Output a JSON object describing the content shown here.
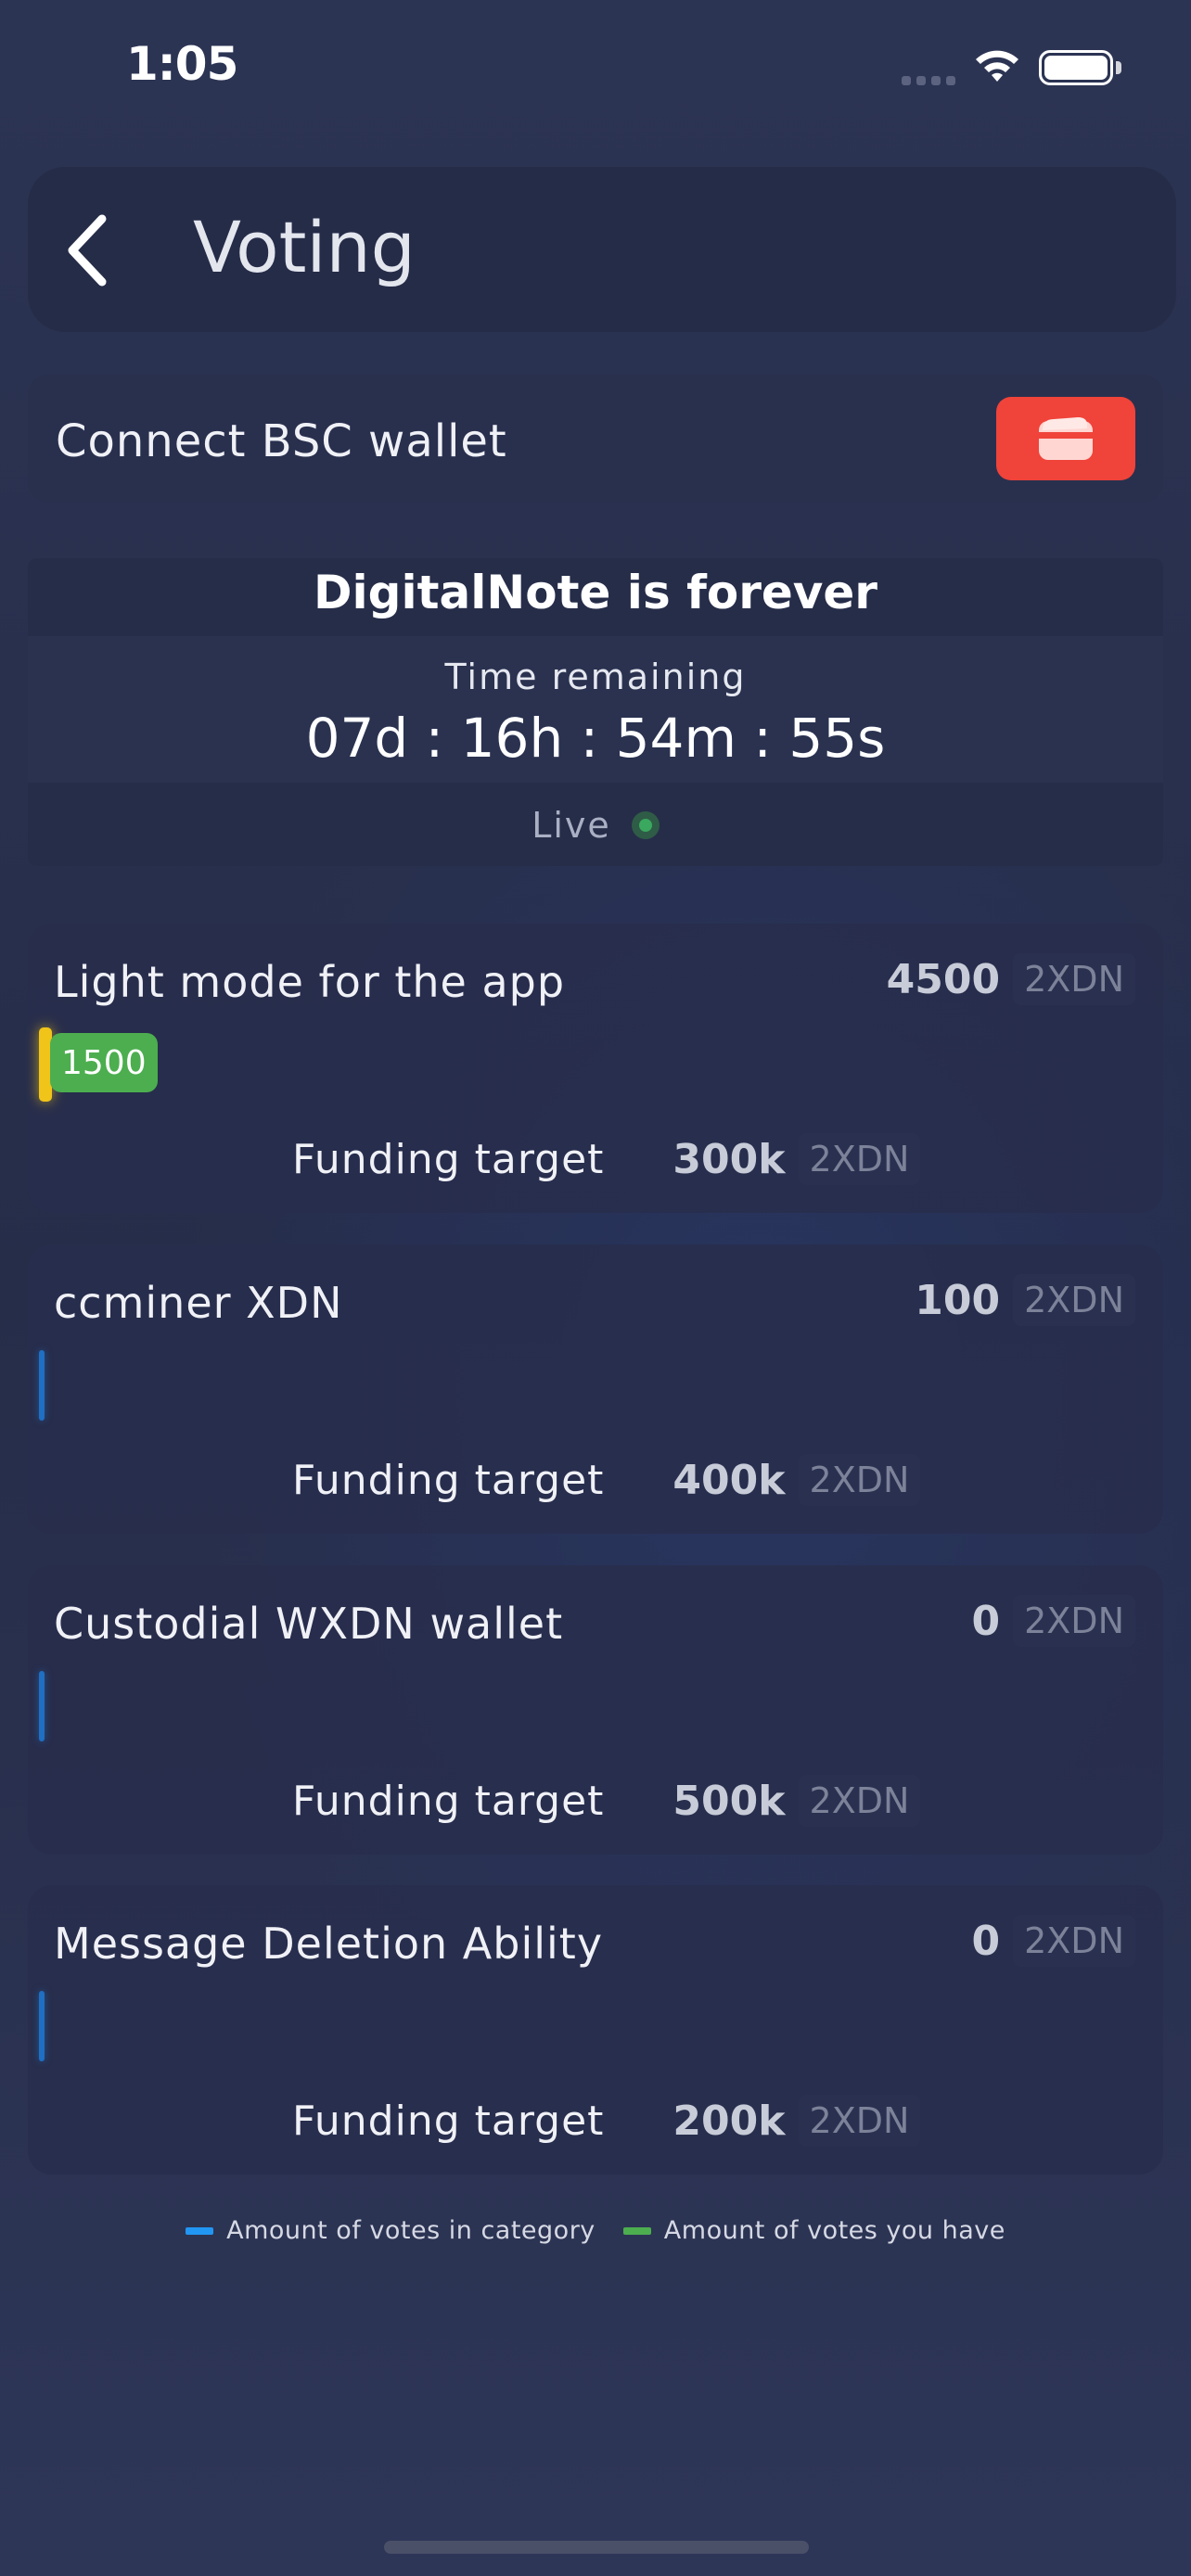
{
  "status_bar": {
    "time": "1:05",
    "battery_level": 1.0
  },
  "header": {
    "title": "Voting",
    "back_icon": "chevron-left-icon"
  },
  "wallet": {
    "label": "Connect BSC wallet",
    "button_icon": "wallet-icon",
    "button_color": "#f0433a"
  },
  "poll": {
    "title": "DigitalNote is forever",
    "time_label": "Time remaining",
    "time_value": "07d : 16h : 54m : 55s",
    "status": "Live",
    "status_color": "#3aa85e"
  },
  "proposals": [
    {
      "title": "Light mode for the app",
      "votes": "4500",
      "unit": "2XDN",
      "my_votes": "1500",
      "target_label": "Funding target",
      "target": "300k",
      "target_unit": "2XDN"
    },
    {
      "title": "ccminer XDN",
      "votes": "100",
      "unit": "2XDN",
      "target_label": "Funding target",
      "target": "400k",
      "target_unit": "2XDN"
    },
    {
      "title": "Custodial WXDN wallet",
      "votes": "0",
      "unit": "2XDN",
      "target_label": "Funding target",
      "target": "500k",
      "target_unit": "2XDN"
    },
    {
      "title": "Message Deletion Ability",
      "votes": "0",
      "unit": "2XDN",
      "target_label": "Funding target",
      "target": "200k",
      "target_unit": "2XDN"
    }
  ],
  "legend": {
    "category_votes": {
      "label": "Amount of votes in category",
      "color": "#2196f3"
    },
    "your_votes": {
      "label": "Amount of votes you have",
      "color": "#4cae4f"
    }
  }
}
